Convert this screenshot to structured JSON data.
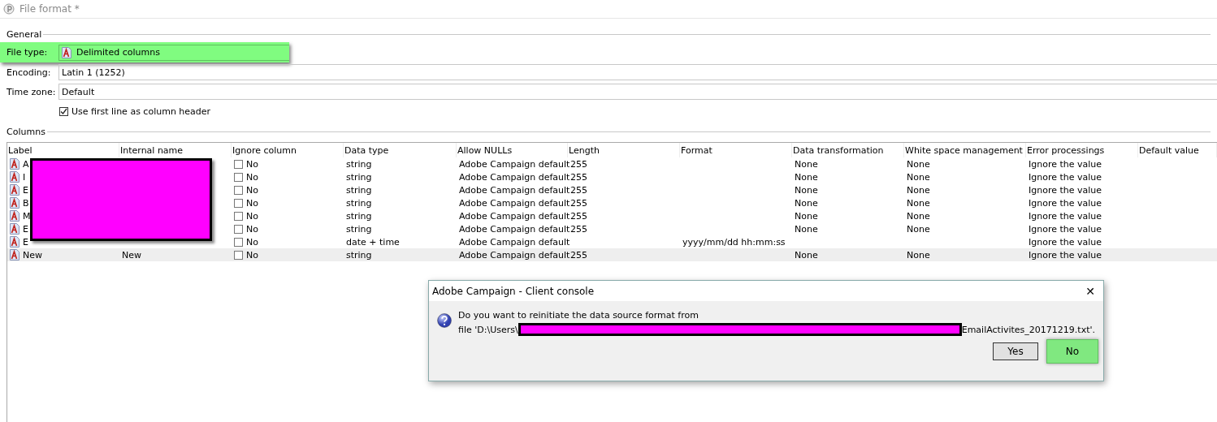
{
  "window": {
    "title": "File format *"
  },
  "general": {
    "legend": "General",
    "file_type": {
      "label": "File type:",
      "value": "Delimited columns",
      "highlighted": true
    },
    "encoding": {
      "label": "Encoding:",
      "value": "Latin 1 (1252)"
    },
    "time_zone": {
      "label": "Time zone:",
      "value": "Default"
    },
    "header_checkbox": {
      "label": "Use first line as column header",
      "checked": true
    }
  },
  "columns": {
    "legend": "Columns",
    "headers": [
      "Label",
      "Internal name",
      "Ignore column",
      "Data type",
      "Allow NULLs",
      "Length",
      "Format",
      "Data transformation",
      "White space management",
      "Error processings",
      "Default value"
    ],
    "rows": [
      {
        "label": "A",
        "internal_name": "",
        "ignore": "No",
        "ignore_checked": false,
        "data_type": "string",
        "allow_nulls": "Adobe Campaign default",
        "length": "255",
        "format": "",
        "transformation": "None",
        "white_space": "None",
        "error": "Ignore the value",
        "selected": false
      },
      {
        "label": "I",
        "internal_name": "",
        "ignore": "No",
        "ignore_checked": false,
        "data_type": "string",
        "allow_nulls": "Adobe Campaign default",
        "length": "255",
        "format": "",
        "transformation": "None",
        "white_space": "None",
        "error": "Ignore the value",
        "selected": false
      },
      {
        "label": "E",
        "internal_name": "",
        "ignore": "No",
        "ignore_checked": false,
        "data_type": "string",
        "allow_nulls": "Adobe Campaign default",
        "length": "255",
        "format": "",
        "transformation": "None",
        "white_space": "None",
        "error": "Ignore the value",
        "selected": false
      },
      {
        "label": "B",
        "internal_name": "",
        "ignore": "No",
        "ignore_checked": false,
        "data_type": "string",
        "allow_nulls": "Adobe Campaign default",
        "length": "255",
        "format": "",
        "transformation": "None",
        "white_space": "None",
        "error": "Ignore the value",
        "selected": false
      },
      {
        "label": "M",
        "internal_name": "",
        "ignore": "No",
        "ignore_checked": false,
        "data_type": "string",
        "allow_nulls": "Adobe Campaign default",
        "length": "255",
        "format": "",
        "transformation": "None",
        "white_space": "None",
        "error": "Ignore the value",
        "selected": false
      },
      {
        "label": "E",
        "internal_name": "",
        "ignore": "No",
        "ignore_checked": false,
        "data_type": "string",
        "allow_nulls": "Adobe Campaign default",
        "length": "255",
        "format": "",
        "transformation": "None",
        "white_space": "None",
        "error": "Ignore the value",
        "selected": false
      },
      {
        "label": "E",
        "internal_name": "",
        "ignore": "No",
        "ignore_checked": false,
        "data_type": "date + time",
        "allow_nulls": "Adobe Campaign default",
        "length": "",
        "format": "yyyy/mm/dd hh:mm:ss",
        "transformation": "",
        "white_space": "",
        "error": "Ignore the value",
        "selected": false
      },
      {
        "label": "New",
        "internal_name": "New",
        "ignore": "No",
        "ignore_checked": false,
        "data_type": "string",
        "allow_nulls": "Adobe Campaign default",
        "length": "255",
        "format": "",
        "transformation": "None",
        "white_space": "None",
        "error": "Ignore the value",
        "selected": true
      }
    ]
  },
  "dialog": {
    "title": "Adobe Campaign - Client console",
    "close": "✕",
    "message_line_1": "Do you want to reinitiate the data source format from",
    "message_prefix": "file 'D:\\Users\\",
    "message_suffix": "EmailActivites_20171219.txt'.",
    "buttons": [
      {
        "label": "Yes",
        "highlighted": false
      },
      {
        "label": "No",
        "highlighted": true
      }
    ]
  }
}
